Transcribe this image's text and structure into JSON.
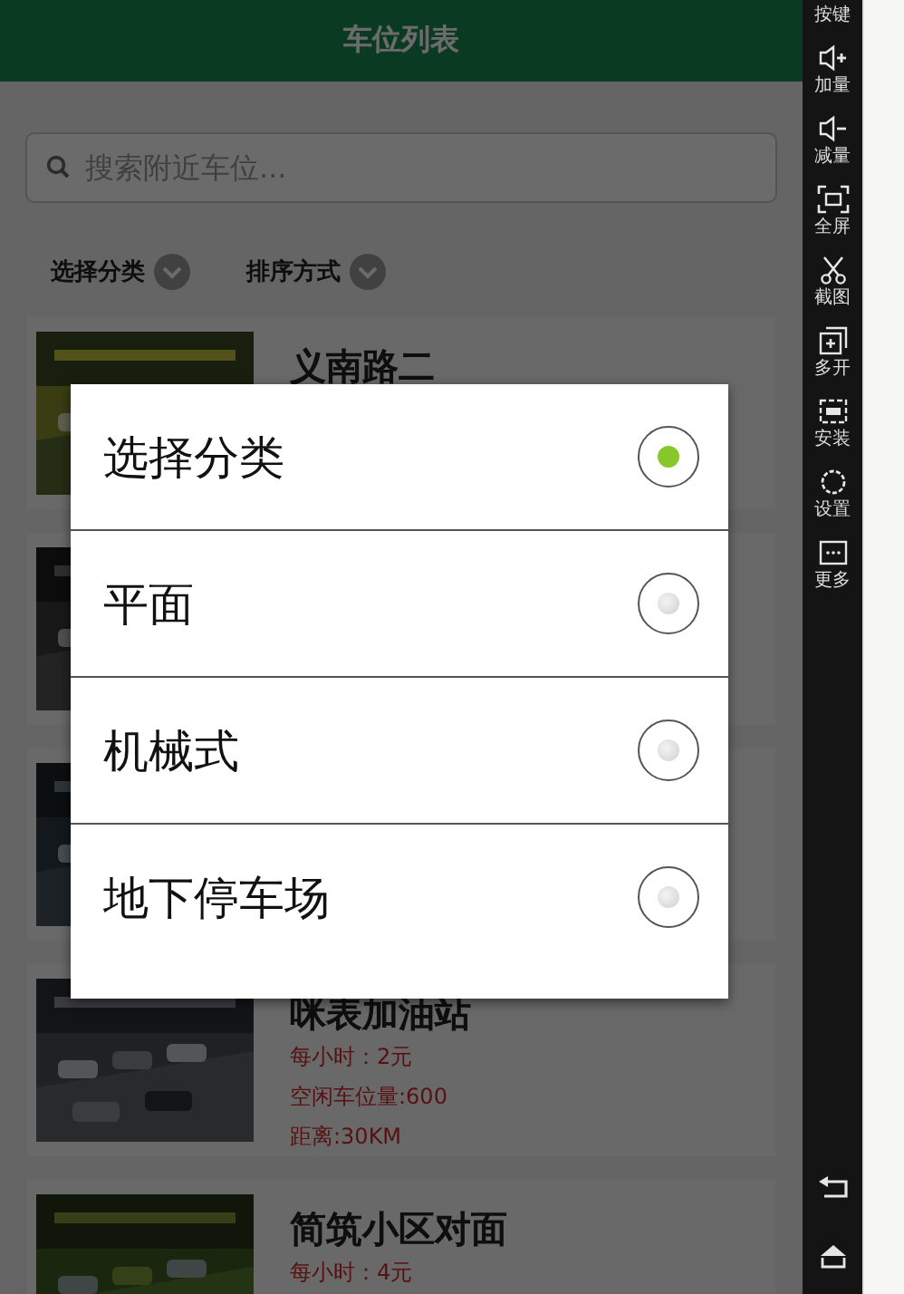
{
  "header": {
    "title": "车位列表"
  },
  "search": {
    "placeholder": "搜索附近车位..."
  },
  "filters": [
    {
      "label": "选择分类"
    },
    {
      "label": "排序方式"
    }
  ],
  "parking_lots": [
    {
      "kind": "picture",
      "title": "义南路二"
    },
    {
      "kind": "picture"
    },
    {
      "kind": "picture"
    },
    {
      "kind": "picture",
      "title": "咪表加油站",
      "details": [
        "每小时：2元",
        "空闲车位量:600",
        "距离:30KM"
      ]
    },
    {
      "kind": "picture",
      "title": "简筑小区对面",
      "details": [
        "每小时：4元"
      ]
    }
  ],
  "dialog": {
    "options": [
      {
        "label": "选择分类",
        "selected": true
      },
      {
        "label": "平面",
        "selected": false
      },
      {
        "label": "机械式",
        "selected": false
      },
      {
        "label": "地下停车场",
        "selected": false
      }
    ]
  },
  "emulator_toolbar": {
    "tools": [
      {
        "label": "按键"
      },
      {
        "label": "加量",
        "kind": "volume-up"
      },
      {
        "label": "减量",
        "kind": "volume-down"
      },
      {
        "label": "全屏",
        "kind": "fullscreen"
      },
      {
        "label": "截图",
        "kind": "scissors"
      },
      {
        "label": "多开",
        "kind": "multi"
      },
      {
        "label": "安装",
        "kind": "apk"
      },
      {
        "label": "设置",
        "kind": "settings"
      },
      {
        "label": "更多",
        "kind": "more"
      }
    ],
    "nav": [
      {
        "kind": "back"
      },
      {
        "kind": "home"
      }
    ]
  }
}
